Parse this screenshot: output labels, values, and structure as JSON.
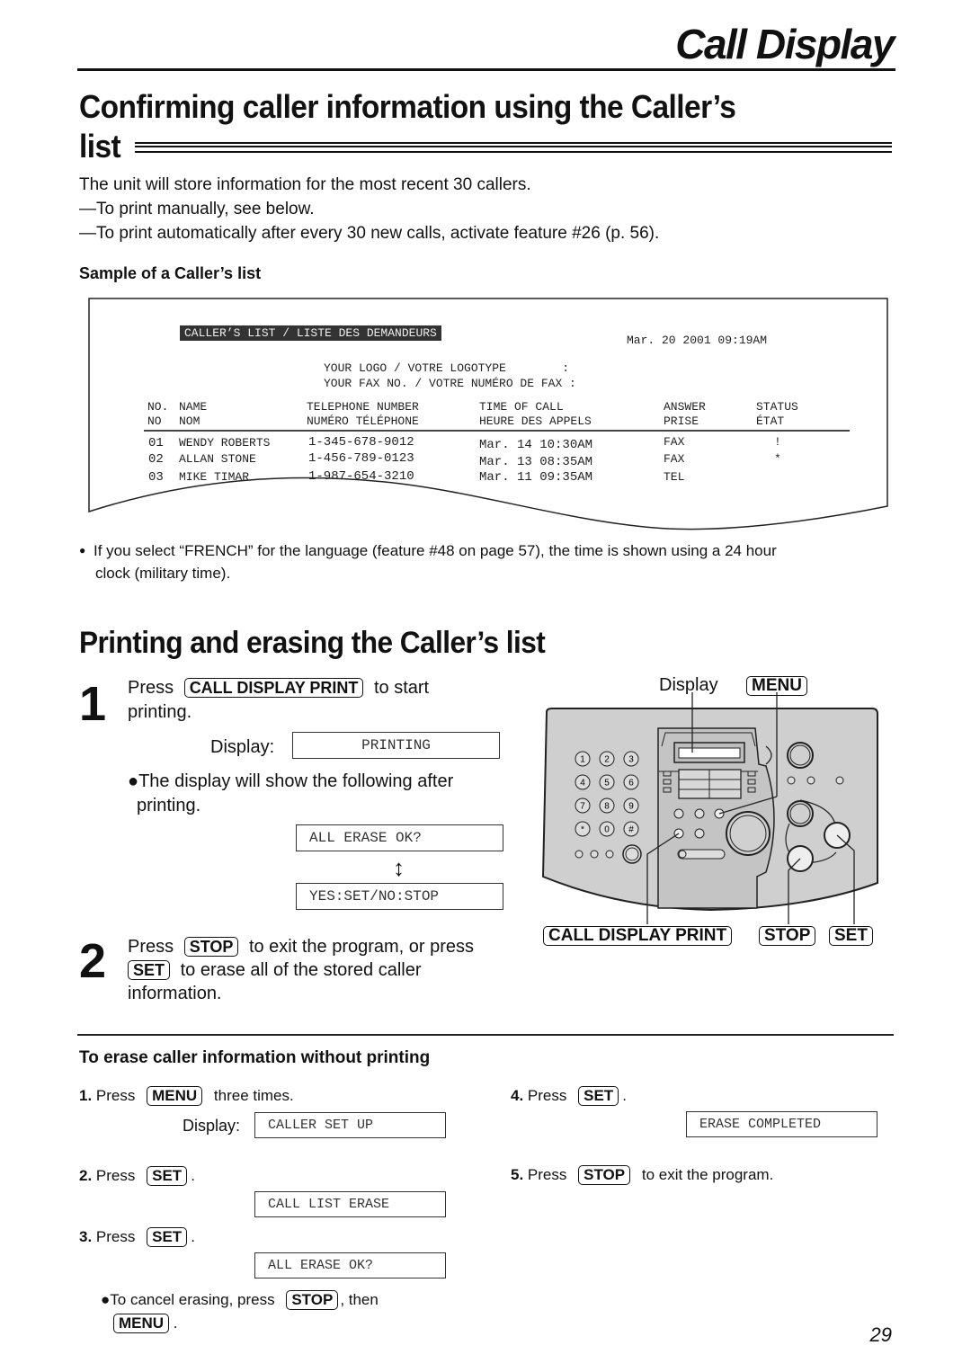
{
  "header": {
    "title": "Call Display"
  },
  "section1": {
    "heading_line1": "Confirming caller information using the Caller’s",
    "heading_line2": "list",
    "intro": "The unit will store information for the most recent 30 callers.",
    "bullet1": "—To print manually, see below.",
    "bullet2": "—To print automatically after every 30 new calls, activate feature #26 (p. 56).",
    "sample_heading": "Sample of a Caller’s list"
  },
  "caller_list_sample": {
    "banner": "CALLER’S LIST / LISTE DES DEMANDEURS",
    "date": "Mar. 20 2001 09:19AM",
    "logo_line": "YOUR LOGO / VOTRE LOGOTYPE        :",
    "fax_line": "YOUR FAX NO. / VOTRE NUMÉRO DE FAX :",
    "columns_en": [
      "NO.",
      "NAME",
      "TELEPHONE NUMBER",
      "TIME OF CALL",
      "ANSWER",
      "STATUS"
    ],
    "columns_fr": [
      "NO",
      "NOM",
      "NUMÉRO TÉLÉPHONE",
      "HEURE DES APPELS",
      "PRISE",
      "ÉTAT"
    ],
    "rows": [
      {
        "no": "01",
        "name": "WENDY ROBERTS",
        "phone": "1-345-678-9012",
        "time": "Mar. 14 10:30AM",
        "answer": "FAX",
        "status": "!"
      },
      {
        "no": "02",
        "name": "ALLAN STONE",
        "phone": "1-456-789-0123",
        "time": "Mar. 13 08:35AM",
        "answer": "FAX",
        "status": "*"
      },
      {
        "no": "03",
        "name": "MIKE TIMAR",
        "phone": "1-987-654-3210",
        "time": "Mar. 11 09:35AM",
        "answer": "TEL",
        "status": ""
      }
    ]
  },
  "note": {
    "bullet": "●",
    "line1": "If you select “FRENCH” for the language (feature #48 on page 57), the time is shown using a 24 hour",
    "line2": "clock (military time)."
  },
  "section2": {
    "heading": "Printing and erasing the Caller’s list",
    "step1": {
      "number": "1",
      "press": "Press",
      "key": "CALL DISPLAY PRINT",
      "after": "to start",
      "line2": "printing.",
      "display_label": "Display:",
      "display_value": "PRINTING",
      "bullet_line1": "●The display will show the following after",
      "bullet_line2": "printing.",
      "lcd_a": "ALL ERASE OK?",
      "lcd_b": "YES:SET/NO:STOP",
      "toggle_arrow": "↕"
    },
    "step2": {
      "number": "2",
      "press": "Press",
      "key_stop": "STOP",
      "after_stop": "to exit the program, or press",
      "key_set": "SET",
      "after_set": "to erase all of the stored caller",
      "line3": "information."
    }
  },
  "diagram": {
    "display_label": "Display",
    "menu_label": "MENU",
    "call_display_print_label": "CALL DISPLAY PRINT",
    "stop_label": "STOP",
    "set_label": "SET",
    "dial_keys": [
      "1",
      "2",
      "3",
      "4",
      "5",
      "6",
      "7",
      "8",
      "9",
      "*",
      "0",
      "#"
    ],
    "panel_color": "#cfcfcf"
  },
  "erase_section": {
    "heading": "To erase caller information without printing",
    "steps": [
      {
        "num": "1.",
        "press": "Press",
        "key": "MENU",
        "after": "three times.",
        "display_label": "Display:",
        "lcd": "CALLER SET UP"
      },
      {
        "num": "2.",
        "press": "Press",
        "key": "SET",
        "after": ".",
        "lcd": "CALL LIST ERASE"
      },
      {
        "num": "3.",
        "press": "Press",
        "key": "SET",
        "after": ".",
        "lcd": "ALL ERASE OK?"
      },
      {
        "num": "4.",
        "press": "Press",
        "key": "SET",
        "after": ".",
        "lcd": "ERASE COMPLETED"
      },
      {
        "num": "5.",
        "press": "Press",
        "key": "STOP",
        "after": "to exit the program."
      }
    ],
    "cancel_note": {
      "prefix": "●To cancel erasing, press",
      "key_stop": "STOP",
      "mid": ", then",
      "key_menu": "MENU",
      "end": "."
    }
  },
  "page_number": "29"
}
